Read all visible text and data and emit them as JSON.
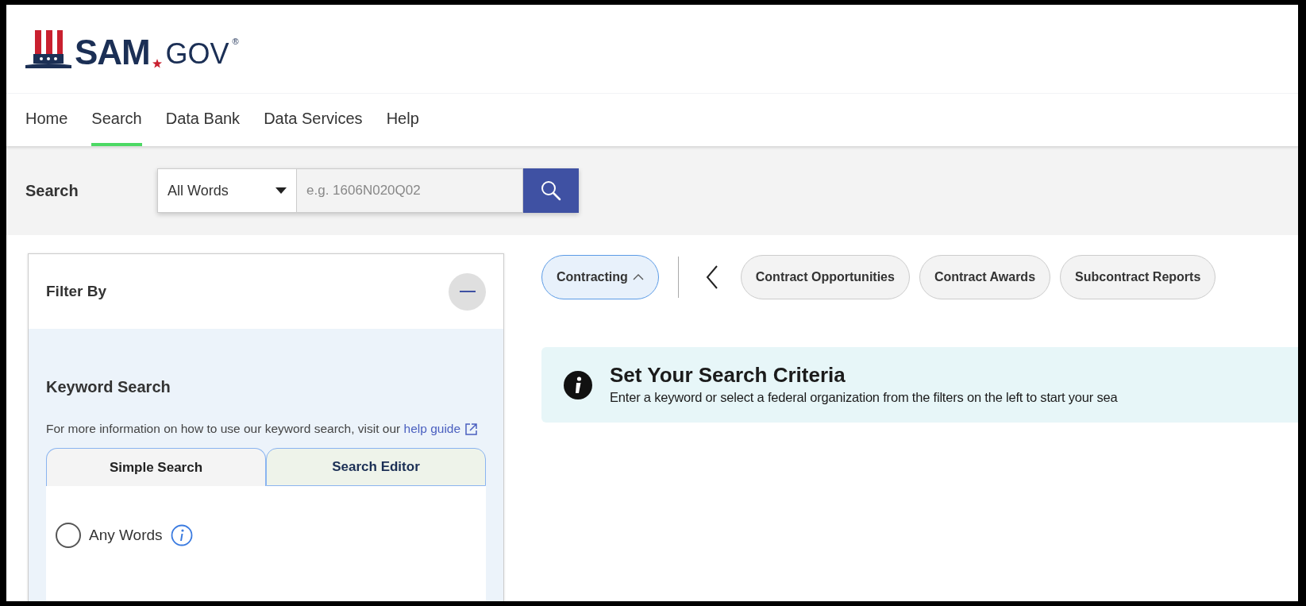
{
  "logo": {
    "text": "SAM",
    "suffix": "GOV",
    "mark": "®"
  },
  "nav": [
    {
      "label": "Home",
      "selected": false
    },
    {
      "label": "Search",
      "selected": true
    },
    {
      "label": "Data Bank",
      "selected": false
    },
    {
      "label": "Data Services",
      "selected": false
    },
    {
      "label": "Help",
      "selected": false
    }
  ],
  "search_bar": {
    "label": "Search",
    "mode": "All Words",
    "placeholder": "e.g. 1606N020Q02"
  },
  "filter_panel": {
    "title": "Filter By",
    "section_title": "Keyword Search",
    "description": "For more information on how to use our keyword search, visit our",
    "link": "help guide",
    "tabs": [
      {
        "label": "Simple Search",
        "selected": true
      },
      {
        "label": "Search Editor",
        "selected": false
      }
    ],
    "options": [
      {
        "label": "Any Words",
        "selected": false
      }
    ]
  },
  "domain_chip": {
    "label": "Contracting",
    "expanded": true
  },
  "chips": [
    {
      "label": "Contract Opportunities"
    },
    {
      "label": "Contract Awards"
    },
    {
      "label": "Subcontract Reports"
    }
  ],
  "alert": {
    "title": "Set Your Search Criteria",
    "message": "Enter a keyword or select a federal organization from the filters on the left to start your sea"
  }
}
